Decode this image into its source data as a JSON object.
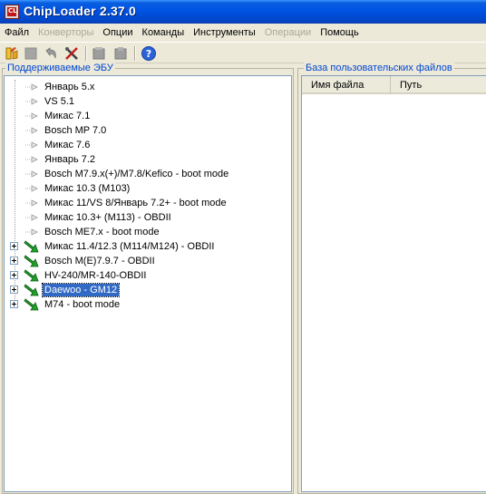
{
  "window": {
    "title": "ChipLoader 2.37.0"
  },
  "menu": [
    {
      "label": "Файл",
      "enabled": true
    },
    {
      "label": "Конверторы",
      "enabled": false
    },
    {
      "label": "Опции",
      "enabled": true
    },
    {
      "label": "Команды",
      "enabled": true
    },
    {
      "label": "Инструменты",
      "enabled": true
    },
    {
      "label": "Операции",
      "enabled": false
    },
    {
      "label": "Помощь",
      "enabled": true
    }
  ],
  "toolbar": [
    {
      "icon": "open-flash-icon"
    },
    {
      "icon": "stop-icon"
    },
    {
      "icon": "undo-icon"
    },
    {
      "icon": "tools-icon"
    },
    {
      "icon": "read-chip-icon"
    },
    {
      "icon": "write-chip-icon"
    },
    {
      "icon": "help-icon"
    }
  ],
  "left_panel": {
    "caption": "Поддерживаемые ЭБУ",
    "items": [
      {
        "label": "Январь 5.x",
        "kind": "plain",
        "expandable": false,
        "selected": false
      },
      {
        "label": "VS 5.1",
        "kind": "plain",
        "expandable": false,
        "selected": false
      },
      {
        "label": "Микас 7.1",
        "kind": "plain",
        "expandable": false,
        "selected": false
      },
      {
        "label": "Bosch MP 7.0",
        "kind": "plain",
        "expandable": false,
        "selected": false
      },
      {
        "label": "Микас 7.6",
        "kind": "plain",
        "expandable": false,
        "selected": false
      },
      {
        "label": "Январь 7.2",
        "kind": "plain",
        "expandable": false,
        "selected": false
      },
      {
        "label": "Bosch M7.9.x(+)/M7.8/Kefico - boot mode",
        "kind": "plain",
        "expandable": false,
        "selected": false
      },
      {
        "label": "Микас 10.3 (M103)",
        "kind": "plain",
        "expandable": false,
        "selected": false
      },
      {
        "label": "Микас 11/VS 8/Январь 7.2+ - boot mode",
        "kind": "plain",
        "expandable": false,
        "selected": false
      },
      {
        "label": "Микас 10.3+ (M113) - OBDII",
        "kind": "plain",
        "expandable": false,
        "selected": false
      },
      {
        "label": "Bosch ME7.x - boot mode",
        "kind": "plain",
        "expandable": false,
        "selected": false
      },
      {
        "label": "Микас 11.4/12.3 (M114/M124) - OBDII",
        "kind": "green",
        "expandable": true,
        "selected": false
      },
      {
        "label": "Bosch M(E)7.9.7 - OBDII",
        "kind": "green",
        "expandable": true,
        "selected": false
      },
      {
        "label": "HV-240/MR-140-OBDII",
        "kind": "green",
        "expandable": true,
        "selected": false
      },
      {
        "label": "Daewoo - GM12",
        "kind": "green",
        "expandable": true,
        "selected": true
      },
      {
        "label": "M74 - boot mode",
        "kind": "green",
        "expandable": true,
        "selected": false
      }
    ]
  },
  "right_panel": {
    "caption": "База пользовательских файлов",
    "columns": [
      "Имя файла",
      "Путь"
    ]
  }
}
